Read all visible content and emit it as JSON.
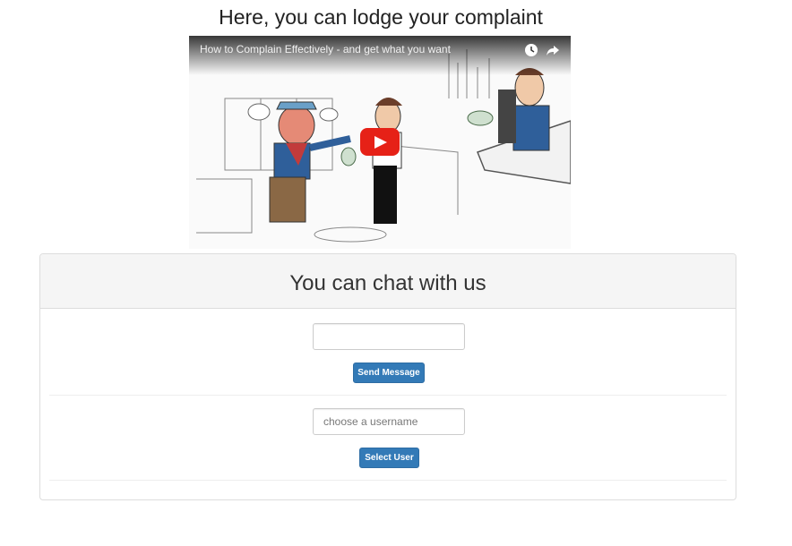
{
  "page": {
    "title": "Here, you can lodge your complaint"
  },
  "video": {
    "title": "How to Complain Effectively - and get what you want",
    "icons": {
      "watch_later": "clock-icon",
      "share": "share-icon",
      "play": "play-icon"
    },
    "colors": {
      "play_button": "#e62117"
    }
  },
  "chat": {
    "heading": "You can chat with us",
    "message": {
      "value": "",
      "placeholder": "",
      "send_label": "Send Message"
    },
    "user": {
      "value": "",
      "placeholder": "choose a username",
      "select_label": "Select User"
    }
  },
  "colors": {
    "primary_button": "#337ab7",
    "panel_heading_bg": "#f5f5f5"
  }
}
